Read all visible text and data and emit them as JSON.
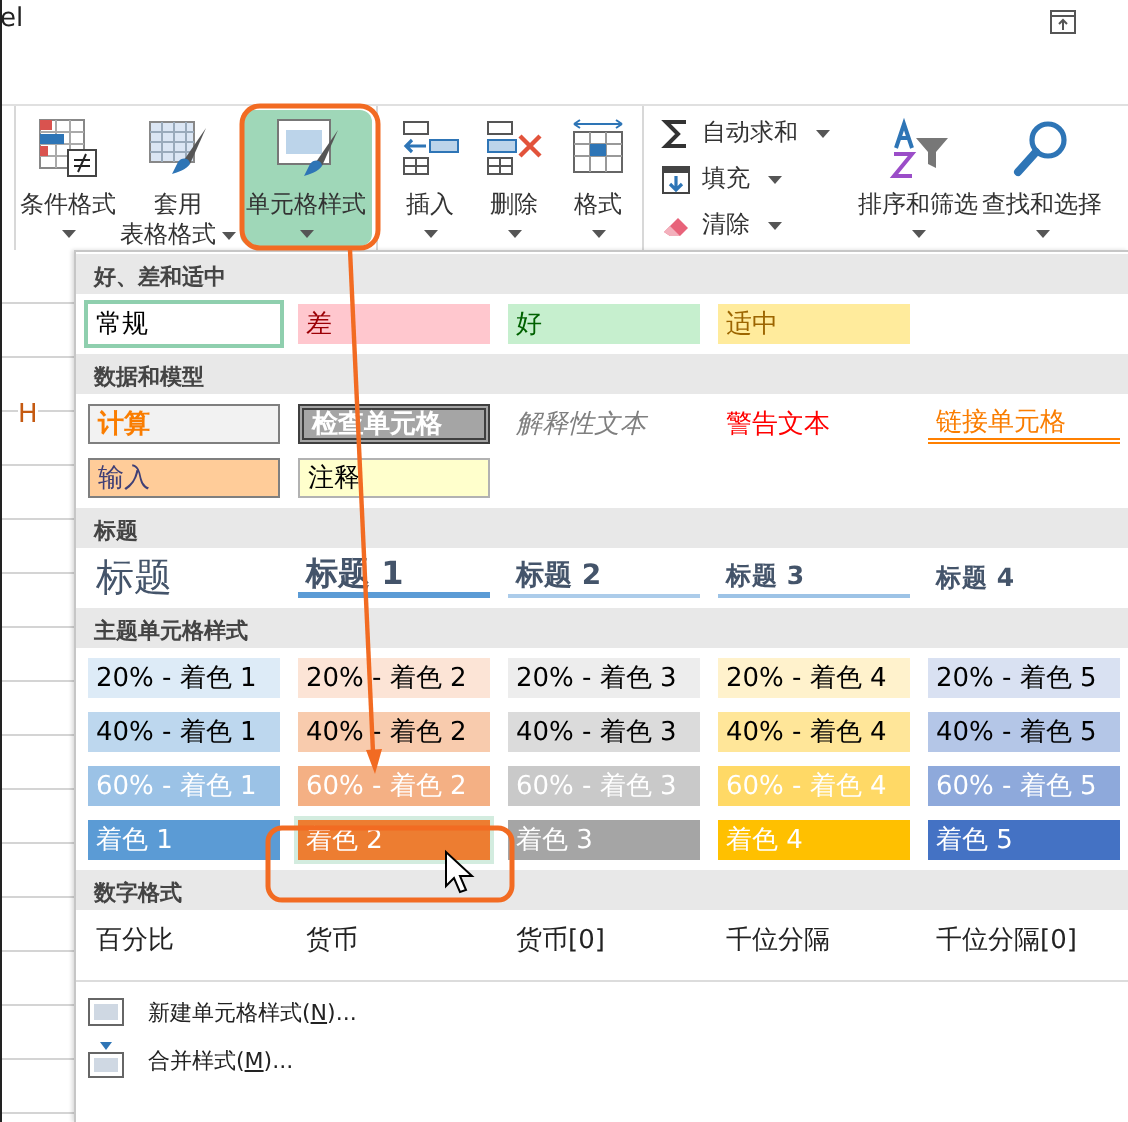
{
  "window": {
    "title": "el"
  },
  "ribbon": {
    "groups": [
      {
        "buttons": [
          {
            "lines": [
              "条件格式"
            ],
            "selected": false
          },
          {
            "lines": [
              "套用",
              "表格格式"
            ],
            "selected": false
          },
          {
            "lines": [
              "单元格样式"
            ],
            "selected": true
          }
        ]
      },
      {
        "buttons": [
          {
            "lines": [
              "插入"
            ],
            "selected": false
          },
          {
            "lines": [
              "删除"
            ],
            "selected": false
          },
          {
            "lines": [
              "格式"
            ],
            "selected": false
          }
        ]
      },
      {
        "small_buttons": [
          {
            "label": "自动求和"
          },
          {
            "label": "填充"
          },
          {
            "label": "清除"
          }
        ],
        "buttons": [
          {
            "lines": [
              "排序和筛选"
            ],
            "selected": false
          },
          {
            "lines": [
              "查找和选择"
            ],
            "selected": false
          }
        ]
      }
    ]
  },
  "sheet": {
    "cell_text": "H"
  },
  "gallery": {
    "sections": [
      {
        "title": "好、差和适中",
        "rows": [
          [
            {
              "label": "常规",
              "kind": "normal",
              "selected": true,
              "hovered": false
            },
            {
              "label": "差",
              "kind": "bad",
              "selected": false,
              "hovered": false
            },
            {
              "label": "好",
              "kind": "good",
              "selected": false,
              "hovered": false
            },
            {
              "label": "适中",
              "kind": "neutral",
              "selected": false,
              "hovered": false
            }
          ]
        ]
      },
      {
        "title": "数据和模型",
        "rows": [
          [
            {
              "label": "计算",
              "kind": "calculation",
              "selected": false,
              "hovered": false
            },
            {
              "label": "检查单元格",
              "kind": "check",
              "selected": false,
              "hovered": false
            },
            {
              "label": "解释性文本",
              "kind": "explanatory",
              "selected": false,
              "hovered": false
            },
            {
              "label": "警告文本",
              "kind": "warning",
              "selected": false,
              "hovered": false
            },
            {
              "label": "链接单元格",
              "kind": "linked",
              "selected": false,
              "hovered": false
            }
          ],
          [
            {
              "label": "输入",
              "kind": "input",
              "selected": false,
              "hovered": false
            },
            {
              "label": "注释",
              "kind": "note",
              "selected": false,
              "hovered": false
            }
          ]
        ]
      },
      {
        "title": "标题",
        "rows": [
          [
            {
              "label": "标题",
              "kind": "title",
              "selected": false,
              "hovered": false
            },
            {
              "label": "标题 1",
              "kind": "heading1",
              "selected": false,
              "hovered": false
            },
            {
              "label": "标题 2",
              "kind": "heading2",
              "selected": false,
              "hovered": false
            },
            {
              "label": "标题 3",
              "kind": "heading3",
              "selected": false,
              "hovered": false
            },
            {
              "label": "标题 4",
              "kind": "heading4",
              "selected": false,
              "hovered": false
            }
          ]
        ]
      },
      {
        "title": "主题单元格样式",
        "rows": [
          [
            {
              "label": "20% - 着色 1",
              "kind": "accent1-20",
              "selected": false,
              "hovered": false
            },
            {
              "label": "20% - 着色 2",
              "kind": "accent2-20",
              "selected": false,
              "hovered": false
            },
            {
              "label": "20% - 着色 3",
              "kind": "accent3-20",
              "selected": false,
              "hovered": false
            },
            {
              "label": "20% - 着色 4",
              "kind": "accent4-20",
              "selected": false,
              "hovered": false
            },
            {
              "label": "20% - 着色 5",
              "kind": "accent5-20",
              "selected": false,
              "hovered": false
            }
          ],
          [
            {
              "label": "40% - 着色 1",
              "kind": "accent1-40",
              "selected": false,
              "hovered": false
            },
            {
              "label": "40% - 着色 2",
              "kind": "accent2-40",
              "selected": false,
              "hovered": false
            },
            {
              "label": "40% - 着色 3",
              "kind": "accent3-40",
              "selected": false,
              "hovered": false
            },
            {
              "label": "40% - 着色 4",
              "kind": "accent4-40",
              "selected": false,
              "hovered": false
            },
            {
              "label": "40% - 着色 5",
              "kind": "accent5-40",
              "selected": false,
              "hovered": false
            }
          ],
          [
            {
              "label": "60% - 着色 1",
              "kind": "accent1-60",
              "selected": false,
              "hovered": false
            },
            {
              "label": "60% - 着色 2",
              "kind": "accent2-60",
              "selected": false,
              "hovered": false
            },
            {
              "label": "60% - 着色 3",
              "kind": "accent3-60",
              "selected": false,
              "hovered": false
            },
            {
              "label": "60% - 着色 4",
              "kind": "accent4-60",
              "selected": false,
              "hovered": false
            },
            {
              "label": "60% - 着色 5",
              "kind": "accent5-60",
              "selected": false,
              "hovered": false
            }
          ],
          [
            {
              "label": "着色 1",
              "kind": "accent1",
              "selected": false,
              "hovered": false
            },
            {
              "label": "着色 2",
              "kind": "accent2",
              "selected": false,
              "hovered": true
            },
            {
              "label": "着色 3",
              "kind": "accent3",
              "selected": false,
              "hovered": false
            },
            {
              "label": "着色 4",
              "kind": "accent4",
              "selected": false,
              "hovered": false
            },
            {
              "label": "着色 5",
              "kind": "accent5",
              "selected": false,
              "hovered": false
            }
          ]
        ]
      },
      {
        "title": "数字格式",
        "rows": [
          [
            {
              "label": "百分比",
              "kind": "number",
              "selected": false,
              "hovered": false
            },
            {
              "label": "货币",
              "kind": "number",
              "selected": false,
              "hovered": false
            },
            {
              "label": "货币[0]",
              "kind": "number",
              "selected": false,
              "hovered": false
            },
            {
              "label": "千位分隔",
              "kind": "number",
              "selected": false,
              "hovered": false
            },
            {
              "label": "千位分隔[0]",
              "kind": "number",
              "selected": false,
              "hovered": false
            }
          ]
        ]
      }
    ],
    "menu_items": [
      {
        "prefix": "新建单元格样式(",
        "access_key": "N",
        "suffix": ")..."
      },
      {
        "prefix": "合并样式(",
        "access_key": "M",
        "suffix": ")..."
      }
    ]
  }
}
